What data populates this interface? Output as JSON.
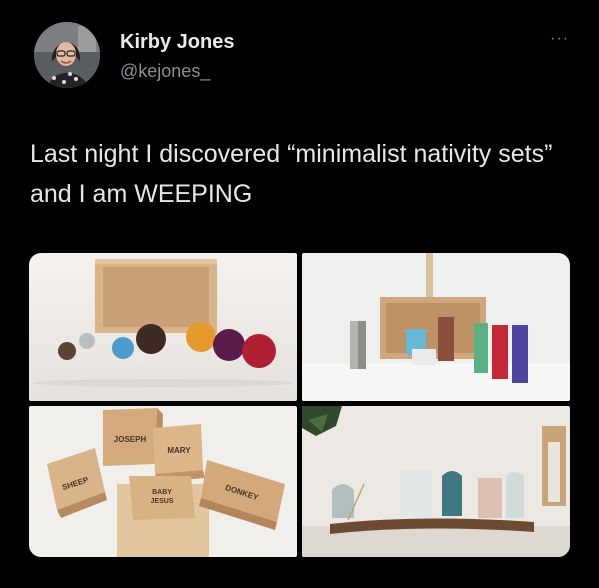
{
  "tweet": {
    "author_name": "Kirby Jones",
    "author_handle": "@kejones_",
    "more_label": "···",
    "text": "Last night I discovered “minimalist nativity sets” and I am WEEPING"
  },
  "photos": {
    "block_labels": {
      "joseph": "JOSEPH",
      "mary": "MARY",
      "sheep": "SHEEP",
      "baby_jesus_line1": "BABY",
      "baby_jesus_line2": "JESUS",
      "donkey": "DONKEY"
    }
  }
}
